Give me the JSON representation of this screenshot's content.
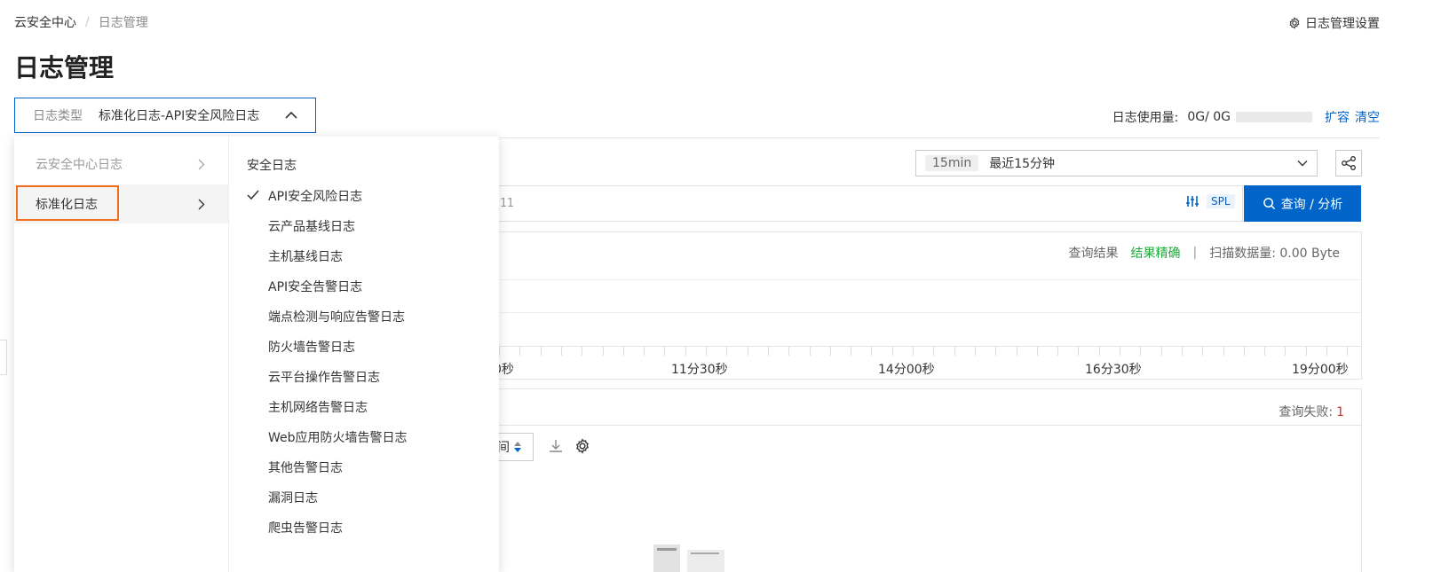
{
  "breadcrumb": {
    "root": "云安全中心",
    "separator": "/",
    "current": "日志管理"
  },
  "header": {
    "settings_label": "日志管理设置",
    "title": "日志管理"
  },
  "log_type": {
    "label": "日志类型",
    "value": "标准化日志-API安全风险日志"
  },
  "usage": {
    "label": "日志使用量:",
    "value": "0G/ 0G",
    "expand": "扩容",
    "clear": "清空"
  },
  "time_range": {
    "chip": "15min",
    "label": "最近15分钟"
  },
  "query": {
    "text": "11",
    "spl": "SPL",
    "button": "查询 / 分析"
  },
  "result": {
    "label": "查询结果",
    "status": "结果精确",
    "pipe": "|",
    "scan": "扫描数据量: 0.00 Byte"
  },
  "axis": {
    "labels": [
      "0秒",
      "11分30秒",
      "14分00秒",
      "16分30秒",
      "19分00秒"
    ]
  },
  "fail": {
    "label": "查询失败:",
    "count": "1"
  },
  "sort": {
    "label": "间"
  },
  "dropdown": {
    "col1": [
      {
        "label": "云安全中心日志"
      },
      {
        "label": "标准化日志"
      }
    ],
    "group_title": "安全日志",
    "options": [
      "API安全风险日志",
      "云产品基线日志",
      "主机基线日志",
      "API安全告警日志",
      "端点检测与响应告警日志",
      "防火墙告警日志",
      "云平台操作告警日志",
      "主机网络告警日志",
      "Web应用防火墙告警日志",
      "其他告警日志",
      "漏洞日志",
      "爬虫告警日志"
    ]
  },
  "colors": {
    "primary": "#0064c8",
    "success": "#1fa83c",
    "danger": "#d93026",
    "highlight": "#ef6f1e"
  }
}
